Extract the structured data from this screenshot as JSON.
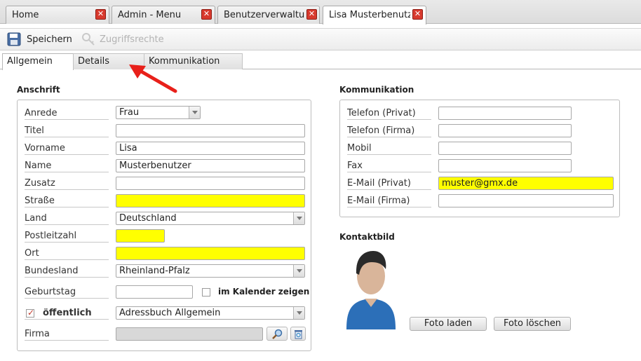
{
  "tabs": [
    {
      "label": "Home",
      "close": "✕"
    },
    {
      "label": "Admin - Menu",
      "close": "✕"
    },
    {
      "label": "Benutzerverwaltur",
      "close": "✕"
    },
    {
      "label": "Lisa Musterbenutz",
      "close": "✕"
    }
  ],
  "toolbar": {
    "save_label": "Speichern",
    "rights_label": "Zugriffsrechte"
  },
  "section_tabs": [
    "Allgemein",
    "Details",
    "Kommunikation"
  ],
  "anschrift": {
    "title": "Anschrift",
    "anrede_label": "Anrede",
    "anrede_value": "Frau",
    "titel_label": "Titel",
    "titel_value": "",
    "vorname_label": "Vorname",
    "vorname_value": "Lisa",
    "name_label": "Name",
    "name_value": "Musterbenutzer",
    "zusatz_label": "Zusatz",
    "zusatz_value": "",
    "strasse_label": "Straße",
    "strasse_value": "",
    "land_label": "Land",
    "land_value": "Deutschland",
    "plz_label": "Postleitzahl",
    "plz_value": "",
    "ort_label": "Ort",
    "ort_value": "",
    "bundesland_label": "Bundesland",
    "bundesland_value": "Rheinland-Pfalz",
    "geburtstag_label": "Geburtstag",
    "geburtstag_value": "",
    "kalender_label": "im Kalender zeigen",
    "kalender_checked": false,
    "oeffentlich_label": "öffentlich",
    "oeffentlich_checked": true,
    "adressbuch_value": "Adressbuch Allgemein",
    "firma_label": "Firma",
    "firma_value": ""
  },
  "kommunikation": {
    "title": "Kommunikation",
    "tel_privat_label": "Telefon (Privat)",
    "tel_privat_value": "",
    "tel_firma_label": "Telefon (Firma)",
    "tel_firma_value": "",
    "mobil_label": "Mobil",
    "mobil_value": "",
    "fax_label": "Fax",
    "fax_value": "",
    "email_privat_label": "E-Mail (Privat)",
    "email_privat_value": "muster@gmx.de",
    "email_firma_label": "E-Mail (Firma)",
    "email_firma_value": ""
  },
  "kontaktbild": {
    "title": "Kontaktbild",
    "load_label": "Foto laden",
    "delete_label": "Foto löschen"
  },
  "colors": {
    "highlight": "#ffff00",
    "close": "#d83a2e",
    "annotation_arrow": "#e8201a"
  }
}
